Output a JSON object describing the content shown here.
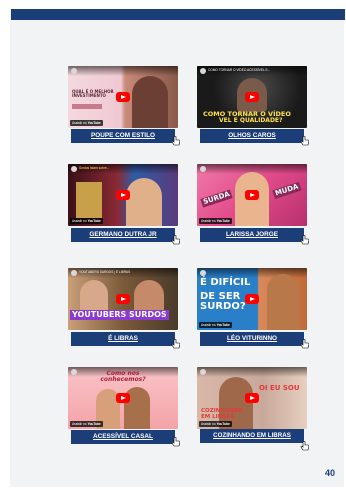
{
  "page_number": "40",
  "watch_label": "Assistir no",
  "youtube_label": "YouTube",
  "videos": [
    {
      "label": "POUPE COM ESTILO",
      "channel": "",
      "overlay_text": "QUAL É O MELHOR INVESTIMENTO",
      "overlay_text_2": "",
      "bg": "#e9b7c1"
    },
    {
      "label": "OLHOS CAROS",
      "channel": "COMO TORNAR O VÍDEO ACESSÍVEL E...",
      "overlay_text": "COMO TORNAR O VÍDEO",
      "overlay_text_2": "VEL E QUALIDADE?",
      "bg": "#1a1a1a"
    },
    {
      "label": "GERMANO DUTRA JR",
      "channel": "Surdos falam sobre...",
      "overlay_text": "",
      "overlay_text_2": "",
      "bg": "#6a1f2a"
    },
    {
      "label": "LARISSA JORGE",
      "channel": "",
      "overlay_text": "SURDA",
      "overlay_text_2": "MUDA",
      "bg": "#e14b8a"
    },
    {
      "label": "É LIBRAS",
      "channel": "YOUTUBERS SURDOS | É LIBRAS",
      "overlay_text": "YOUTUBERS SURDOS",
      "overlay_text_2": "",
      "bg": "#7b5a3a"
    },
    {
      "label": "LÉO VITURINNO",
      "channel": "",
      "overlay_text": "É DIFÍCIL",
      "overlay_text_2": "DE SER SURDO?",
      "bg": "#2a7fc9"
    },
    {
      "label": "ACESSÍVEL CASAL",
      "channel": "",
      "overlay_text": "Como nos conhecemos?",
      "overlay_text_2": "",
      "bg": "#f4a3a8"
    },
    {
      "label": "COZINHANDO EM LIBRAS",
      "channel": "",
      "overlay_text": "OI EU SOU",
      "overlay_text_2": "COZINHANDO EM LIBRAS",
      "bg": "#c8a89a"
    }
  ]
}
